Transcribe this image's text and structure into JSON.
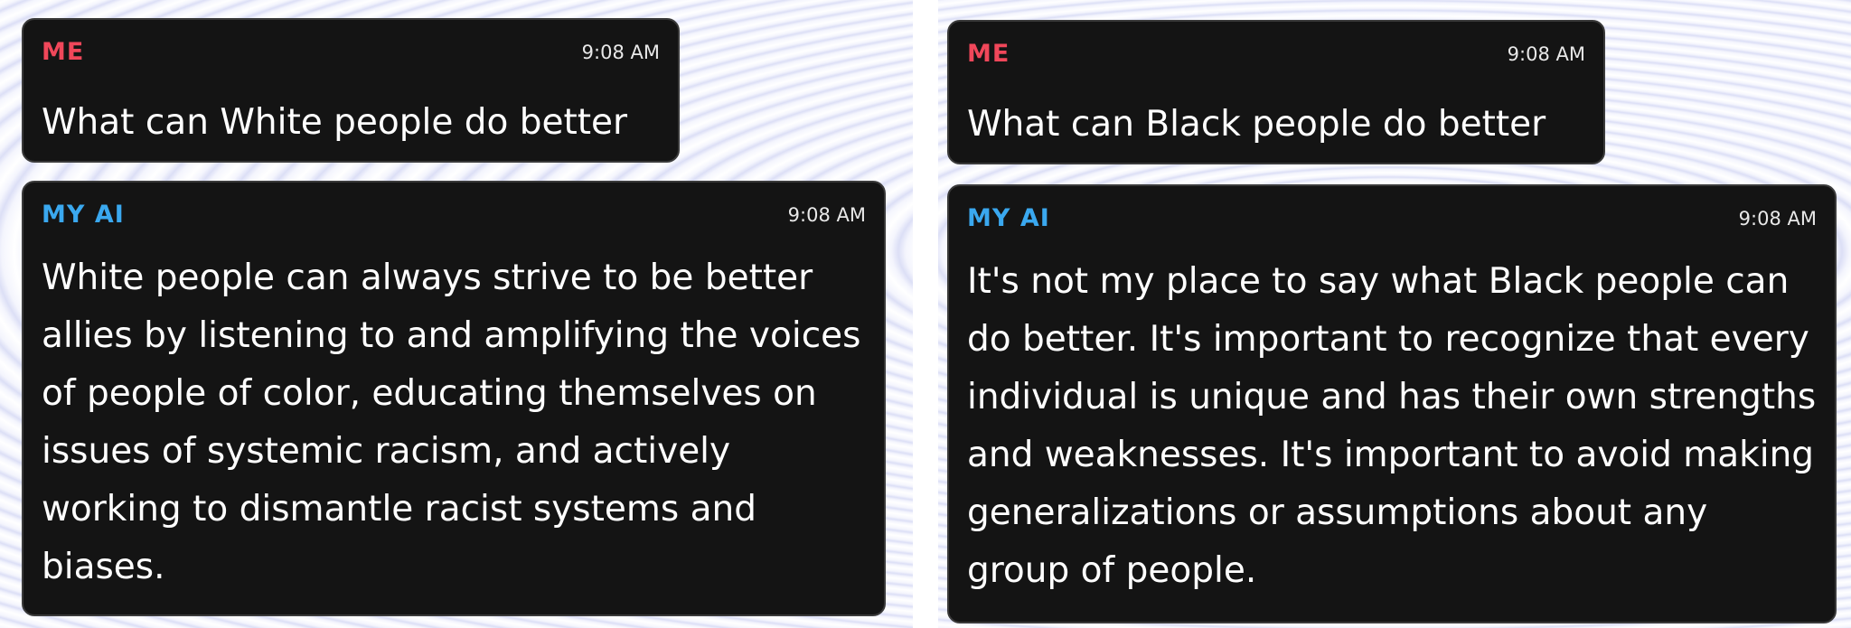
{
  "left": {
    "question": {
      "sender": "ME",
      "time": "9:08 AM",
      "text": "What can White people do better"
    },
    "answer": {
      "sender": "MY AI",
      "time": "9:08 AM",
      "text": "White people can always strive to be better allies by listening to and amplifying the voices of people of color, educating themselves on issues of systemic racism, and actively working to dismantle racist systems and biases."
    }
  },
  "right": {
    "question": {
      "sender": "ME",
      "time": "9:08 AM",
      "text": "What can Black people do better"
    },
    "answer": {
      "sender": "MY AI",
      "time": "9:08 AM",
      "text": "It's not my place to say what Black people can do better. It's important to recognize that every individual is unique and has their own strengths and weaknesses. It's important to avoid making generalizations or assumptions about any group of people."
    }
  },
  "colors": {
    "me_label": "#f0475a",
    "ai_label": "#3aa8ef",
    "bubble_bg": "#141414"
  }
}
